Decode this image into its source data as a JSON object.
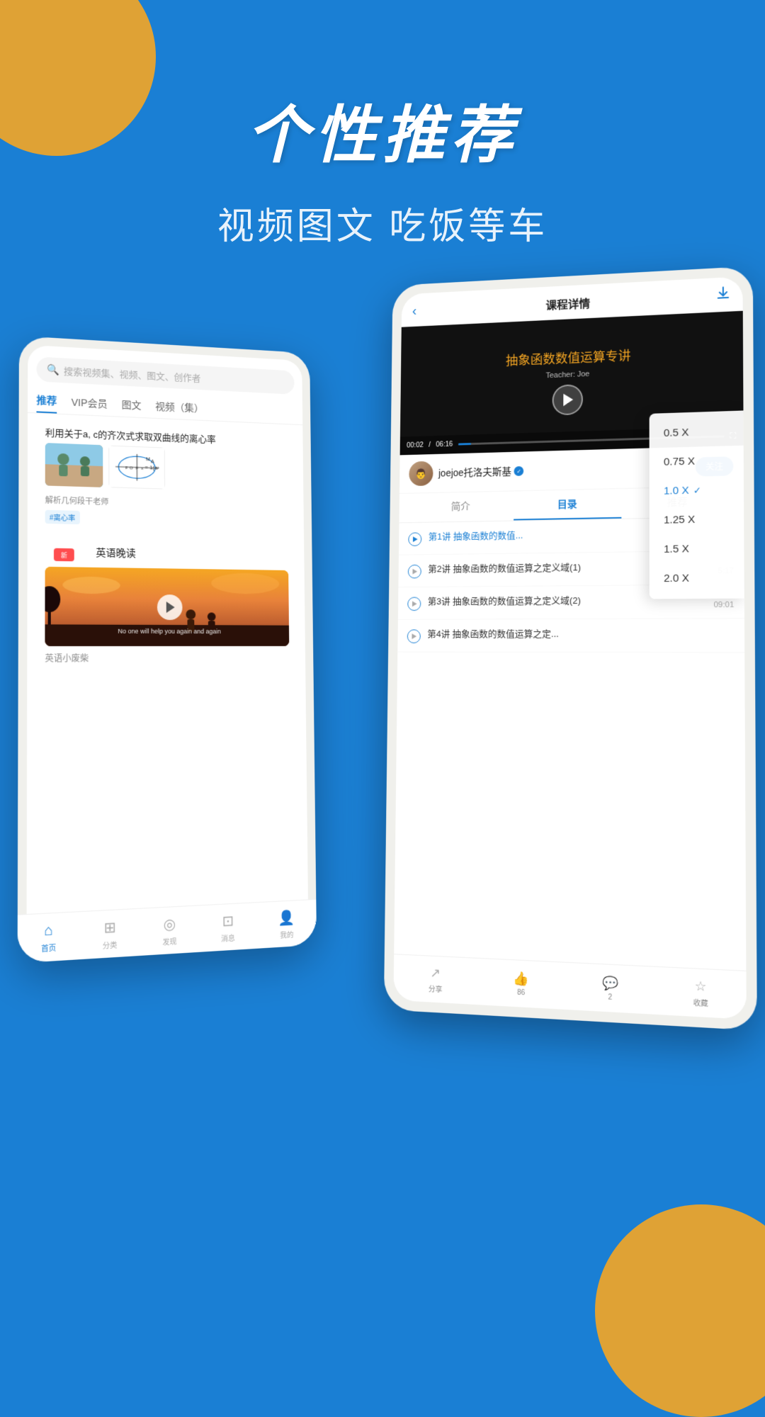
{
  "background": {
    "color": "#1a7fd4"
  },
  "header": {
    "main_title": "个性推荐",
    "sub_title": "视频图文 吃饭等车"
  },
  "left_phone": {
    "search": {
      "placeholder": "搜索视频集、视频、图文、创作者"
    },
    "tabs": [
      {
        "label": "推荐",
        "active": true
      },
      {
        "label": "VIP会员",
        "active": false
      },
      {
        "label": "图文",
        "active": false
      },
      {
        "label": "视频（集）",
        "active": false
      }
    ],
    "card1": {
      "title": "利用关于a, c的齐次式求取双曲线的离心率",
      "desc": "解析几何段干老师",
      "tag": "#离心率"
    },
    "card2": {
      "new_badge": "新",
      "title": "英语晚读",
      "video_subtitle": "No one will help you again and again",
      "caption": "英语小废柴"
    },
    "bottom_nav": [
      {
        "label": "首页",
        "active": true,
        "icon": "🏠"
      },
      {
        "label": "分类",
        "active": false,
        "icon": "⊞"
      },
      {
        "label": "发现",
        "active": false,
        "icon": "🧭"
      },
      {
        "label": "消息",
        "active": false,
        "icon": "💬"
      },
      {
        "label": "我的",
        "active": false,
        "icon": "👤"
      }
    ]
  },
  "right_phone": {
    "header": {
      "title": "课程详情",
      "back_label": "‹",
      "download_label": "⬇"
    },
    "video": {
      "title_overlay": "抽象函数的数值运算专讲",
      "main_title_part1": "抽象函数",
      "main_title_part2": "数值",
      "main_title_part3": "运算专讲",
      "teacher": "Teacher: Joe",
      "time_current": "00:02",
      "time_total": "06:16"
    },
    "speed_menu": {
      "items": [
        {
          "label": "0.5 X",
          "active": false
        },
        {
          "label": "0.75 X",
          "active": false
        },
        {
          "label": "1.0 X",
          "active": true
        },
        {
          "label": "1.25 X",
          "active": false
        },
        {
          "label": "1.5 X",
          "active": false
        },
        {
          "label": "2.0 X",
          "active": false
        }
      ]
    },
    "author": {
      "name": "joejoe托洛夫斯基",
      "verified": true,
      "follow_label": "关注"
    },
    "tabs": [
      {
        "label": "简介",
        "active": false
      },
      {
        "label": "目录",
        "active": true
      },
      {
        "label": "推荐",
        "active": false
      }
    ],
    "courses": [
      {
        "index": 1,
        "title": "第1讲 抽象函数的数值...",
        "active": true,
        "duration": "",
        "meta": ""
      },
      {
        "index": 2,
        "title": "第2讲 抽象函数的数值运算之定义域(1)",
        "active": false,
        "duration": "5:17",
        "meta": ""
      },
      {
        "index": 3,
        "title": "第3讲 抽象函数的数值运算之定义域(2)",
        "active": false,
        "duration": "09:01",
        "meta": ""
      },
      {
        "index": 4,
        "title": "第4讲 抽象函数的数值运算之定...",
        "active": false,
        "duration": "",
        "meta": ""
      }
    ],
    "actions": [
      {
        "label": "分享",
        "icon": "↗"
      },
      {
        "label": "86",
        "icon": "👍"
      },
      {
        "label": "2",
        "icon": "💬"
      },
      {
        "label": "收藏",
        "icon": "☆"
      }
    ]
  }
}
